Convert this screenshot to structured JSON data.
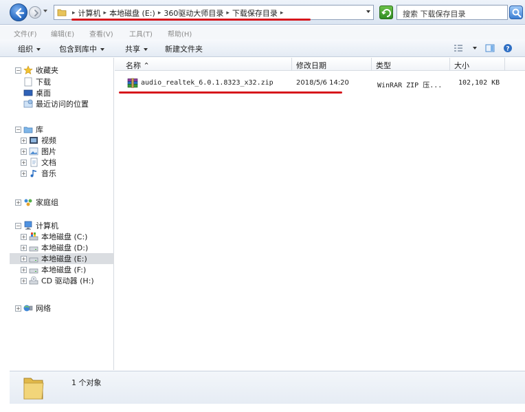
{
  "address": {
    "crumbs": [
      "计算机",
      "本地磁盘 (E:)",
      "360驱动大师目录",
      "下载保存目录"
    ],
    "separator": "▸"
  },
  "search": {
    "placeholder": "搜索 下载保存目录"
  },
  "menu": {
    "items": [
      "文件(F)",
      "编辑(E)",
      "查看(V)",
      "工具(T)",
      "帮助(H)"
    ]
  },
  "toolbar": {
    "organize": "组织",
    "include_in_library": "包含到库中",
    "share": "共享",
    "new_folder": "新建文件夹"
  },
  "nav": {
    "favorites": {
      "label": "收藏夹",
      "items": [
        "下载",
        "桌面",
        "最近访问的位置"
      ]
    },
    "libraries": {
      "label": "库",
      "items": [
        "视频",
        "图片",
        "文档",
        "音乐"
      ]
    },
    "homegroup": {
      "label": "家庭组"
    },
    "computer": {
      "label": "计算机",
      "items": [
        "本地磁盘 (C:)",
        "本地磁盘 (D:)",
        "本地磁盘 (E:)",
        "本地磁盘 (F:)",
        "CD 驱动器 (H:)"
      ],
      "selected_index": 2
    },
    "network": {
      "label": "网络"
    }
  },
  "columns": {
    "name": "名称",
    "modified": "修改日期",
    "type": "类型",
    "size": "大小"
  },
  "files": [
    {
      "name": "audio_realtek_6.0.1.8323_x32.zip",
      "modified": "2018/5/6 14:20",
      "type": "WinRAR ZIP 压...",
      "size": "102,102 KB"
    }
  ],
  "status": {
    "text": "1 个对象"
  },
  "colors": {
    "annotation_red": "#d6141b",
    "selection_gray": "#dadde1",
    "chrome_blue": "#dbe5f2"
  }
}
